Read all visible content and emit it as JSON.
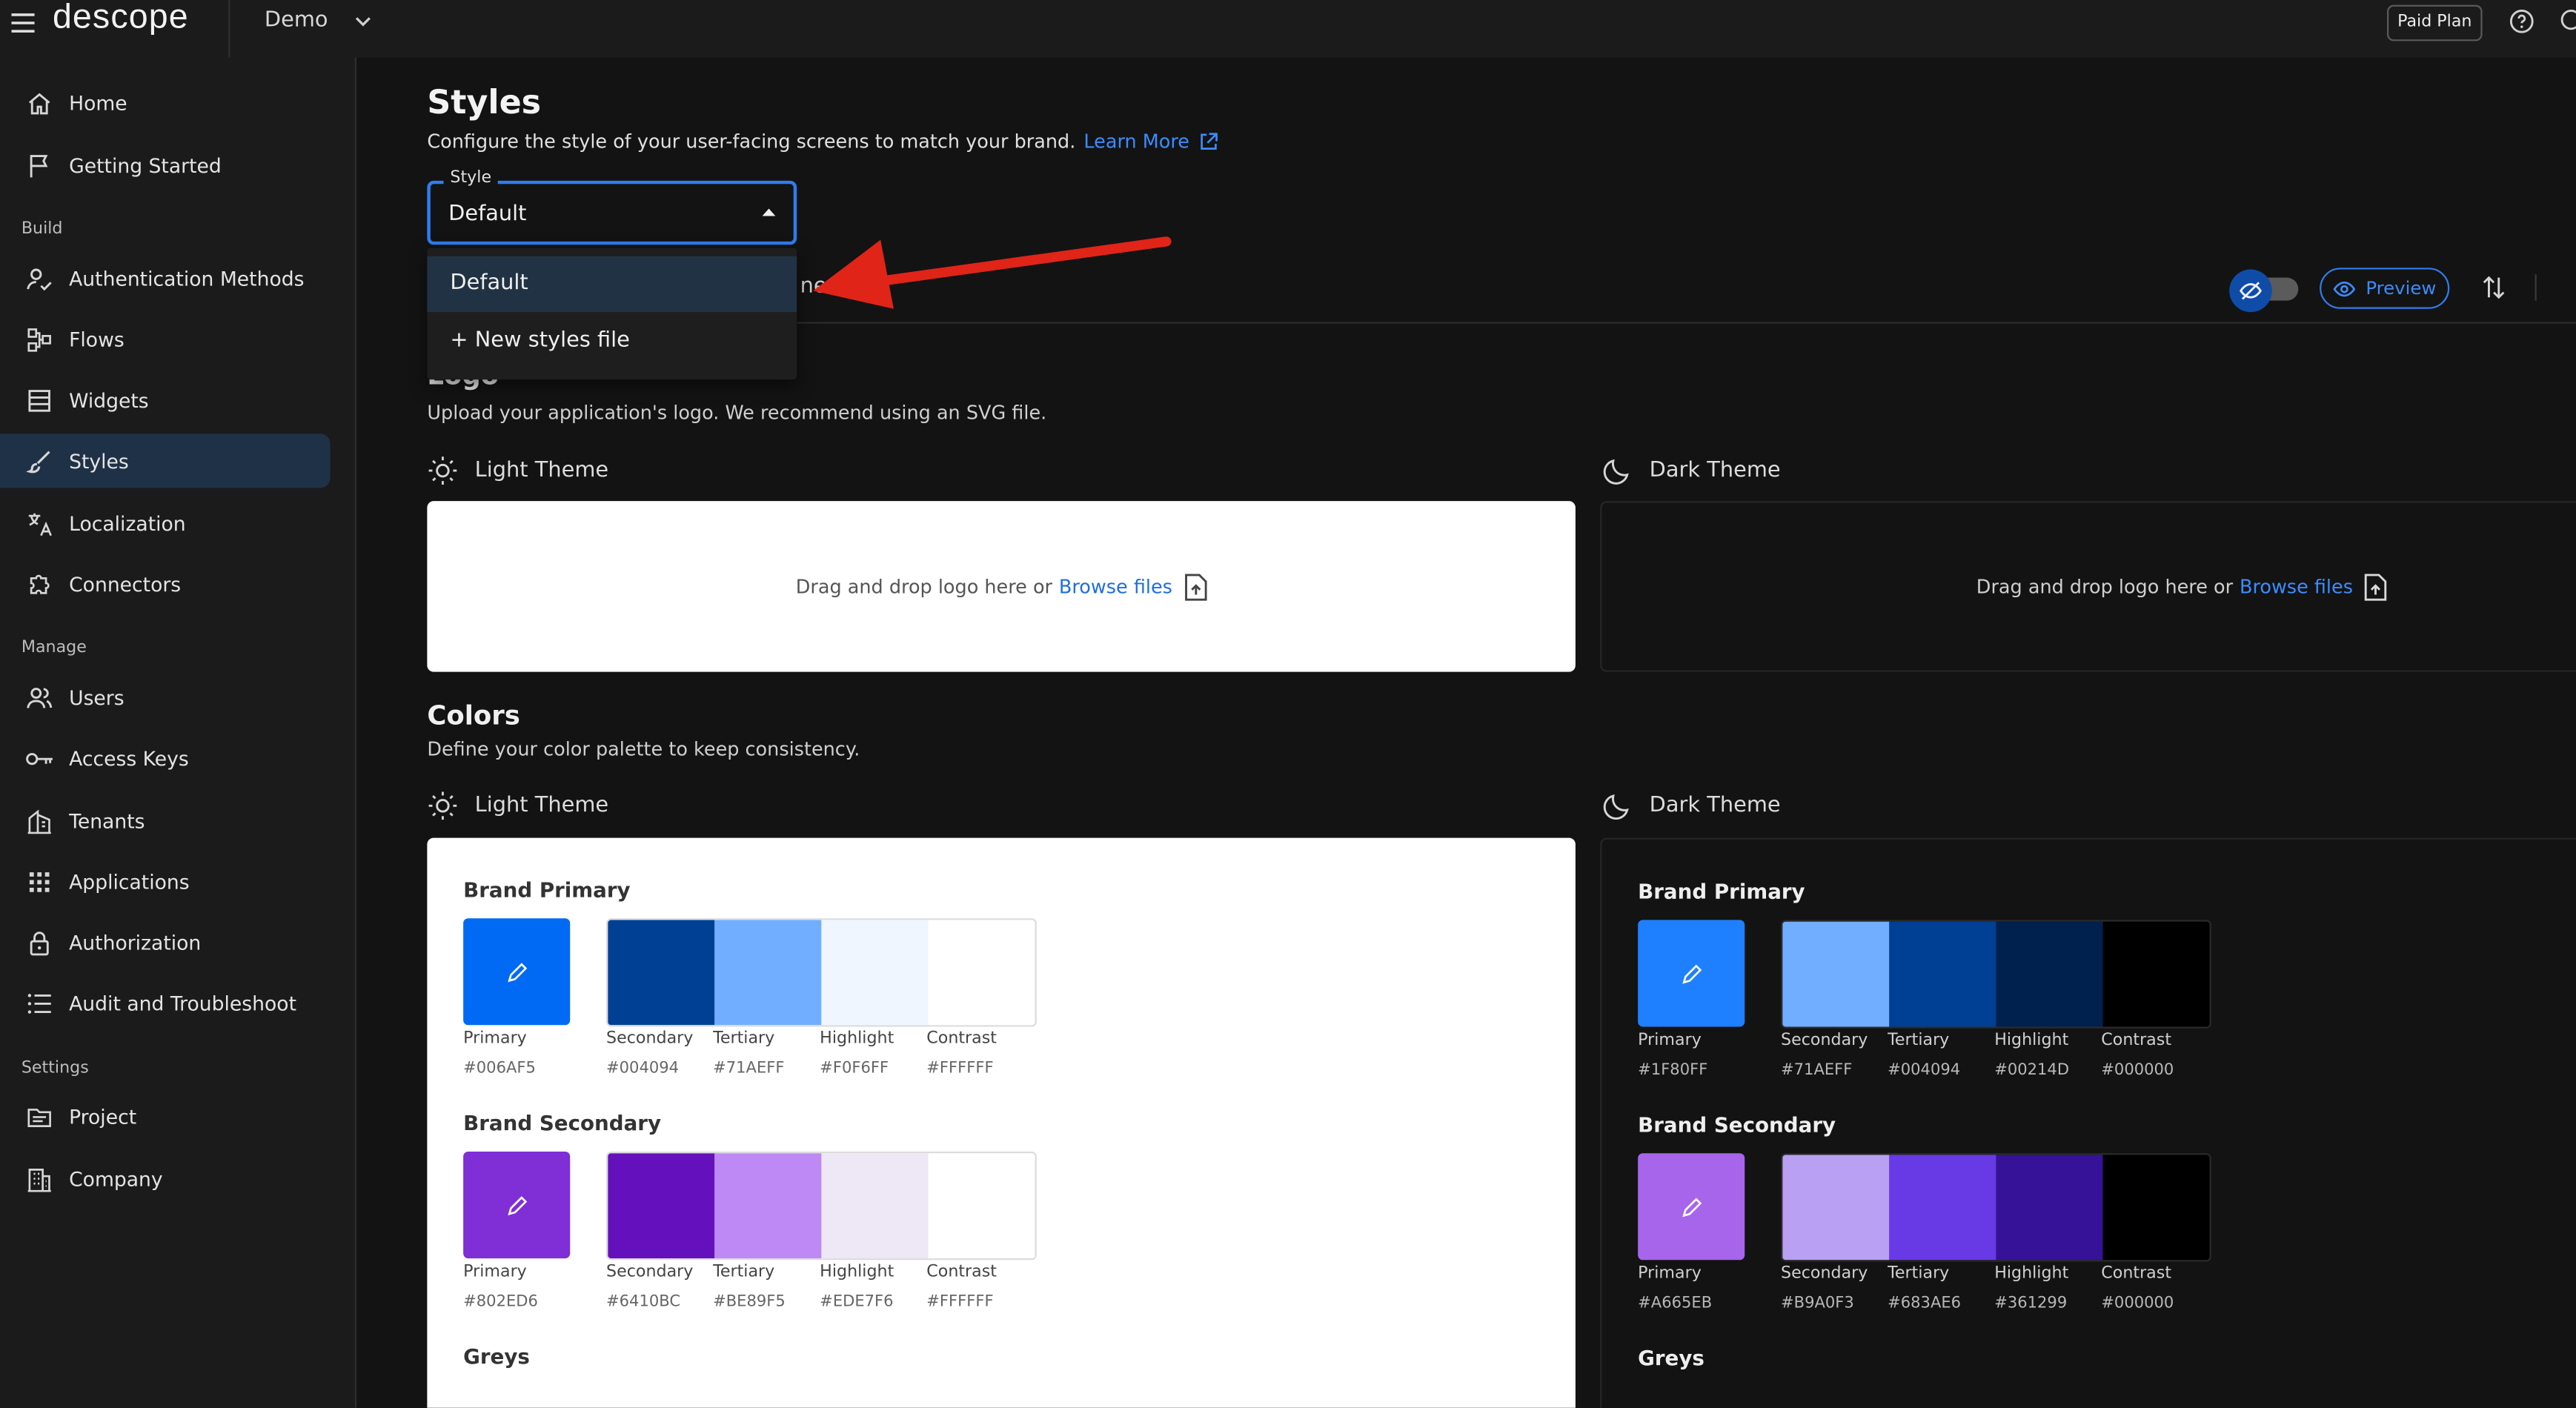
{
  "topbar": {
    "logo_text": "descope",
    "project": "Demo",
    "plan_badge": "Paid Plan"
  },
  "sidebar": {
    "items": [
      {
        "label": "Home",
        "icon": "home-icon"
      },
      {
        "label": "Getting Started",
        "icon": "flag-icon"
      },
      {
        "label": "Authentication Methods",
        "icon": "user-check-icon"
      },
      {
        "label": "Flows",
        "icon": "flow-icon"
      },
      {
        "label": "Widgets",
        "icon": "widgets-icon"
      },
      {
        "label": "Styles",
        "icon": "brush-icon"
      },
      {
        "label": "Localization",
        "icon": "translate-icon"
      },
      {
        "label": "Connectors",
        "icon": "puzzle-icon"
      },
      {
        "label": "Users",
        "icon": "users-icon"
      },
      {
        "label": "Access Keys",
        "icon": "key-icon"
      },
      {
        "label": "Tenants",
        "icon": "tenants-icon"
      },
      {
        "label": "Applications",
        "icon": "apps-grid-icon"
      },
      {
        "label": "Authorization",
        "icon": "lock-icon"
      },
      {
        "label": "Audit and Troubleshoot",
        "icon": "list-icon"
      },
      {
        "label": "Project",
        "icon": "project-icon"
      },
      {
        "label": "Company",
        "icon": "building-icon"
      }
    ],
    "sections": {
      "build": "Build",
      "manage": "Manage",
      "settings": "Settings"
    }
  },
  "page": {
    "title": "Styles",
    "subtitle": "Configure the style of your user-facing screens to match your brand.",
    "learn_more": "Learn More"
  },
  "style_select": {
    "label": "Style",
    "value": "Default",
    "options": [
      "Default",
      "+ New styles file"
    ]
  },
  "tabs_fragment": "nents",
  "toolbar": {
    "preview": "Preview"
  },
  "logo_section": {
    "title": "Logo",
    "description": "Upload your application's logo. We recommend using an SVG file.",
    "light_theme": "Light Theme",
    "dark_theme": "Dark Theme",
    "drop_text": "Drag and drop logo here or",
    "browse": "Browse files"
  },
  "colors_section": {
    "title": "Colors",
    "description": "Define your color palette to keep consistency.",
    "light_theme": "Light Theme",
    "dark_theme": "Dark Theme",
    "light": {
      "brand_primary": {
        "title": "Brand Primary",
        "swatches": [
          {
            "label": "Primary",
            "hex": "#006AF5"
          },
          {
            "label": "Secondary",
            "hex": "#004094"
          },
          {
            "label": "Tertiary",
            "hex": "#71AEFF"
          },
          {
            "label": "Highlight",
            "hex": "#F0F6FF"
          },
          {
            "label": "Contrast",
            "hex": "#FFFFFF"
          }
        ]
      },
      "brand_secondary": {
        "title": "Brand Secondary",
        "swatches": [
          {
            "label": "Primary",
            "hex": "#802ED6"
          },
          {
            "label": "Secondary",
            "hex": "#6410BC"
          },
          {
            "label": "Tertiary",
            "hex": "#BE89F5"
          },
          {
            "label": "Highlight",
            "hex": "#EDE7F6"
          },
          {
            "label": "Contrast",
            "hex": "#FFFFFF"
          }
        ]
      },
      "greys_title": "Greys"
    },
    "dark": {
      "brand_primary": {
        "title": "Brand Primary",
        "swatches": [
          {
            "label": "Primary",
            "hex": "#1F80FF"
          },
          {
            "label": "Secondary",
            "hex": "#71AEFF"
          },
          {
            "label": "Tertiary",
            "hex": "#004094"
          },
          {
            "label": "Highlight",
            "hex": "#00214D"
          },
          {
            "label": "Contrast",
            "hex": "#000000"
          }
        ]
      },
      "brand_secondary": {
        "title": "Brand Secondary",
        "swatches": [
          {
            "label": "Primary",
            "hex": "#A665EB"
          },
          {
            "label": "Secondary",
            "hex": "#B9A0F3"
          },
          {
            "label": "Tertiary",
            "hex": "#683AE6"
          },
          {
            "label": "Highlight",
            "hex": "#361299"
          },
          {
            "label": "Contrast",
            "hex": "#000000"
          }
        ]
      },
      "greys_title": "Greys"
    }
  },
  "colors": {
    "accent": "#1F80FF",
    "link": "#3b8cff",
    "annotation_arrow": "#e02418"
  }
}
